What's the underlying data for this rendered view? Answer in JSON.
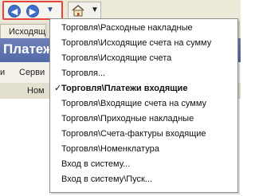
{
  "toolbar": {
    "back_icon": "arrow-left-icon",
    "forward_icon": "arrow-right-icon",
    "history_dropdown_icon": "chevron-down-icon",
    "home_icon": "home-icon",
    "home_dropdown_icon": "chevron-down-icon",
    "nav_glyphs": {
      "back": "◀",
      "forward": "▶",
      "dropdown": "▼"
    },
    "accent_red": "#e6453d",
    "nav_blue": "#3f6fc8"
  },
  "tabs": [
    {
      "label": "Исходящ"
    }
  ],
  "header": {
    "title": "Платежи вх"
  },
  "menu": {
    "items": [
      "и",
      "Серви"
    ]
  },
  "grid": {
    "column_partial": "Ном"
  },
  "dropdown": {
    "items": [
      {
        "label": "Торговля\\Расходные накладные",
        "current": false
      },
      {
        "label": "Торговля\\Исходящие счета на сумму",
        "current": false
      },
      {
        "label": "Торговля\\Исходящие счета",
        "current": false
      },
      {
        "label": "Торговля...",
        "current": false
      },
      {
        "label": "Торговля\\Платежи входящие",
        "current": true
      },
      {
        "label": "Торговля\\Входящие счета на сумму",
        "current": false
      },
      {
        "label": "Торговля\\Приходные накладные",
        "current": false
      },
      {
        "label": "Торговля\\Счета-фактуры входящие",
        "current": false
      },
      {
        "label": "Торговля\\Номенклатура",
        "current": false
      },
      {
        "label": "Вход в систему...",
        "current": false
      },
      {
        "label": "Вход в систему\\Пуск...",
        "current": false
      }
    ],
    "check_glyph": "✓"
  }
}
